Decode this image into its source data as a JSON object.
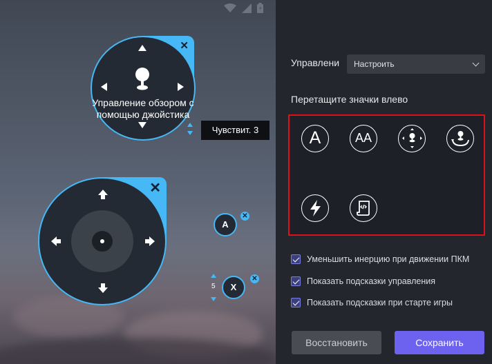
{
  "canvas": {
    "look_joystick": {
      "label": "Управление обзором с помощью джойстика",
      "close_glyph": "✕"
    },
    "sensitivity": {
      "label": "Чувствит. 3"
    },
    "move_joystick": {
      "close_glyph": "✕"
    },
    "key_a": {
      "label": "A",
      "close_glyph": "✕"
    },
    "key_x": {
      "label": "X",
      "count": "5",
      "close_glyph": "✕"
    }
  },
  "panel": {
    "control_label": "Управлени",
    "control_select": "Настроить",
    "drag_hint": "Перетащите значки влево",
    "palette": {
      "items": [
        {
          "icon": "key-a-icon",
          "text": "A"
        },
        {
          "icon": "key-aa-icon",
          "text": "AA"
        },
        {
          "icon": "joystick-icon"
        },
        {
          "icon": "view-rotate-icon"
        },
        {
          "icon": "lightning-icon"
        },
        {
          "icon": "script-icon"
        }
      ]
    },
    "checkboxes": [
      {
        "label": "Уменьшить инерцию при движении ПКМ",
        "checked": true
      },
      {
        "label": "Показать подсказки управления",
        "checked": true
      },
      {
        "label": "Показать подсказки при старте игры",
        "checked": true
      }
    ],
    "restore_button": "Восстановить",
    "save_button": "Сохранить"
  },
  "colors": {
    "accent_blue": "#45b8f5",
    "save_purple": "#6c62ef",
    "highlight_red": "#e0101b"
  }
}
